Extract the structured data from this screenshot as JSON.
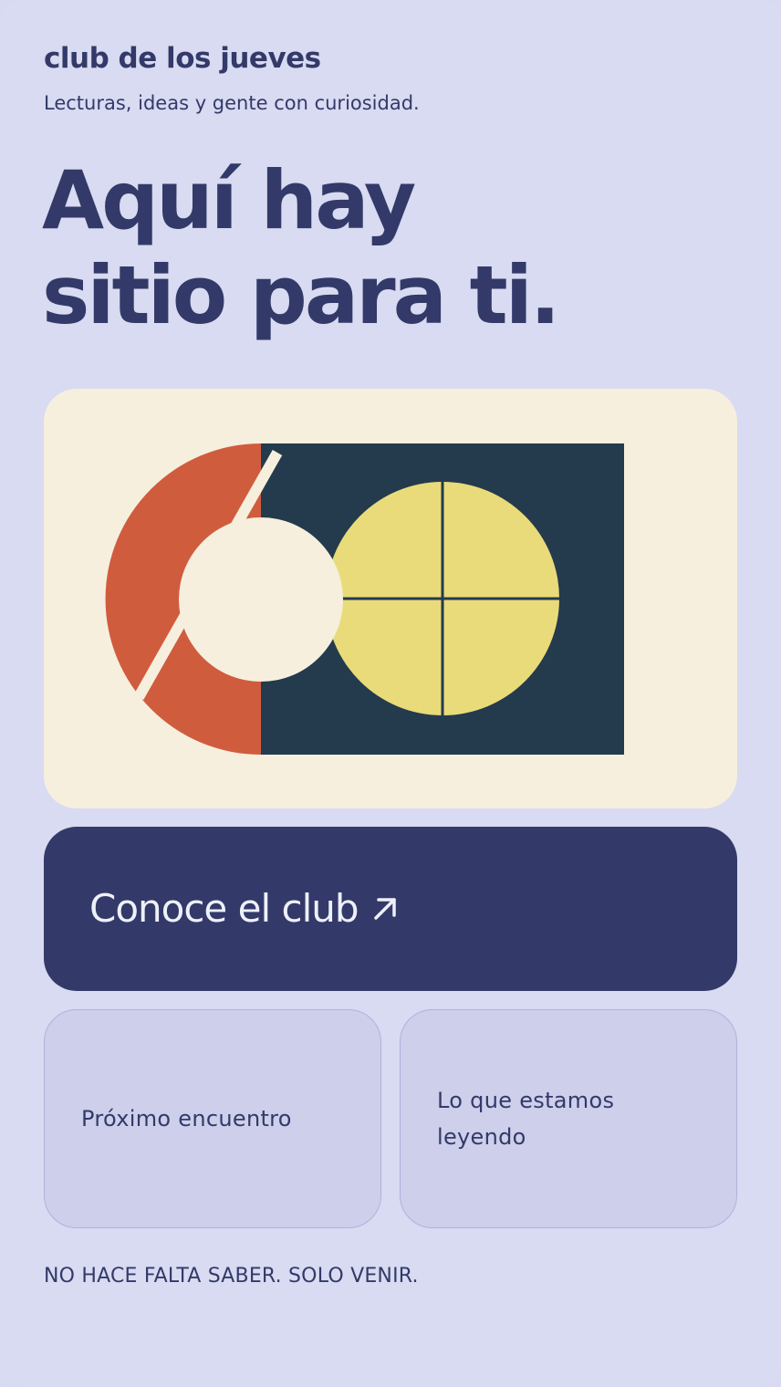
{
  "header": {
    "brand": "club de los jueves",
    "tagline": "Lecturas, ideas y gente con curiosidad."
  },
  "hero": {
    "line1": "Aquí hay",
    "line2": "sitio para ti."
  },
  "illustration": {
    "colors": {
      "background": "#f7efdd",
      "orange": "#d05c3e",
      "navy": "#243a4d",
      "yellow": "#e9db79",
      "cream": "#f7efdd"
    }
  },
  "cta": {
    "label": "Conoce el club",
    "icon": "arrow-up-right-icon"
  },
  "tiles": [
    {
      "label": "Próximo encuentro"
    },
    {
      "label": "Lo que estamos leyendo"
    }
  ],
  "footer": {
    "note": "NO HACE FALTA SABER. SOLO VENIR."
  },
  "theme": {
    "page_bg": "#d8dbf1",
    "ink": "#333a69",
    "tile_bg": "#cdcfeb"
  }
}
